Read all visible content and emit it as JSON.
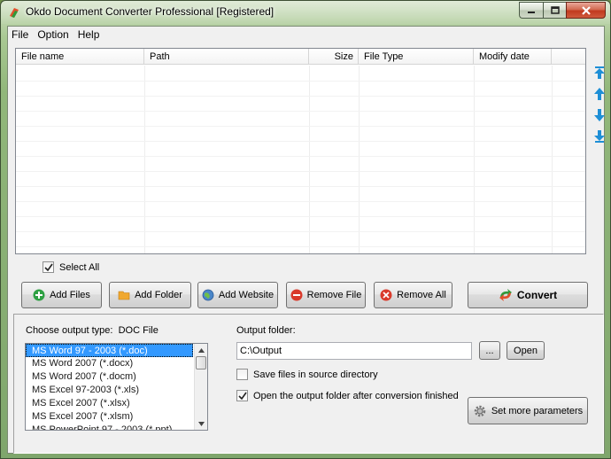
{
  "window": {
    "title": "Okdo Document Converter Professional [Registered]"
  },
  "menu": [
    "File",
    "Option",
    "Help"
  ],
  "file_list": {
    "columns": [
      "File name",
      "Path",
      "Size",
      "File Type",
      "Modify date"
    ],
    "rows": []
  },
  "select_all": {
    "label": "Select All",
    "checked": true
  },
  "toolbar": {
    "add_files": "Add Files",
    "add_folder": "Add Folder",
    "add_website": "Add Website",
    "remove_file": "Remove File",
    "remove_all": "Remove All",
    "convert": "Convert"
  },
  "output": {
    "type_label": "Choose output type:",
    "type_value": "DOC File",
    "formats": [
      "MS Word 97 - 2003 (*.doc)",
      "MS Word 2007 (*.docx)",
      "MS Word 2007 (*.docm)",
      "MS Excel 97-2003 (*.xls)",
      "MS Excel 2007 (*.xlsx)",
      "MS Excel 2007 (*.xlsm)",
      "MS PowerPoint 97 - 2003 (*.ppt)"
    ],
    "selected_format": "MS Word 97 - 2003 (*.doc)",
    "folder_label": "Output folder:",
    "folder_value": "C:\\Output",
    "browse_label": "...",
    "open_label": "Open",
    "save_in_source_label": "Save files in source directory",
    "save_in_source_checked": false,
    "open_after_label": "Open the output folder after conversion finished",
    "open_after_checked": true,
    "set_params_label": "Set more parameters"
  },
  "colors": {
    "selection": "#3399ff",
    "arrow_blue": "#1e8fd6",
    "add_green": "#2ea043",
    "remove_red": "#d93a2b"
  }
}
